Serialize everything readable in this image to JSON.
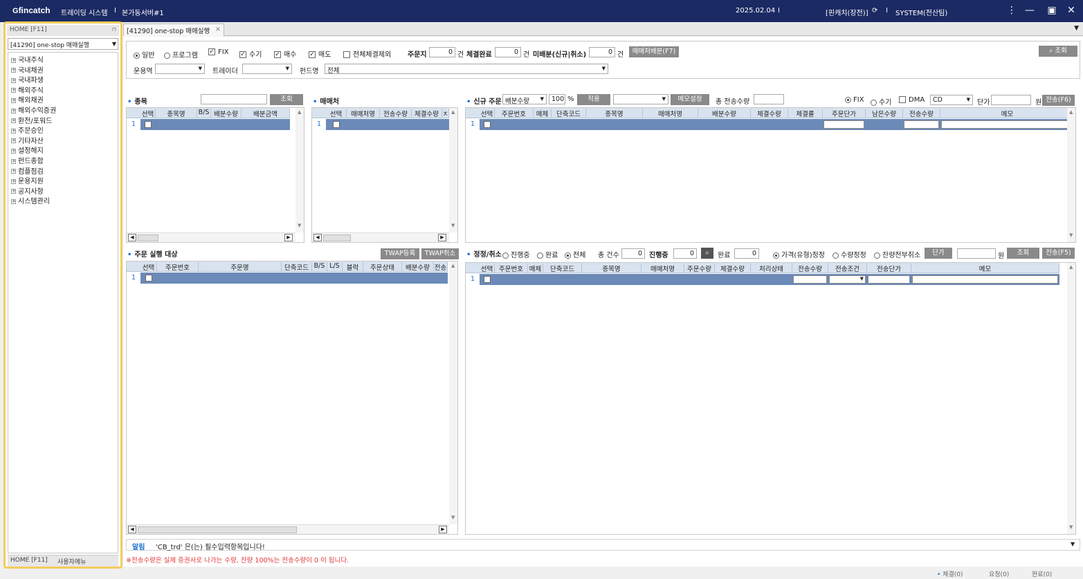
{
  "titlebar": {
    "logo": "fincatch",
    "app": "트레이딩 시스템",
    "sep1": "I",
    "server": "본가동서버#1",
    "date": "2025.02.04",
    "sep2": "I",
    "user_company": "[핀캐치(장전)]",
    "sep3": "I",
    "user": "SYSTEM(전산팀)"
  },
  "left": {
    "home_label": "HOME [F11]",
    "selected_menu": "[41290] one-stop 매매실행",
    "tree": [
      "국내주식",
      "국내채권",
      "국내파생",
      "해외주식",
      "해외채권",
      "해외수익증권",
      "환전/포워드",
      "주문승인",
      "기타자산",
      "설정해지",
      "펀드종합",
      "컴플점검",
      "운용지원",
      "공지사항",
      "시스템관리"
    ],
    "tab_home": "HOME [F11]",
    "tab_user": "사용자메뉴"
  },
  "tabs": {
    "active": "[41290] one-stop 매매실행"
  },
  "filter": {
    "radio_normal": "일반",
    "radio_program": "프로그램",
    "chk_fix": "FIX",
    "chk_manual": "수기",
    "chk_buy": "매수",
    "chk_sell": "매도",
    "chk_exclude_all": "전체체결제외",
    "order_label": "주문지",
    "order_count": "0",
    "unit": "건",
    "done_label": "체결완료",
    "done_count": "0",
    "unalloc_label": "미배분(신규|취소)",
    "unalloc_count": "0",
    "alloc_button": "매매처배분(F7)",
    "search_button": "조회",
    "manager_label": "운용역",
    "trader_label": "트레이더",
    "fund_label": "펀드명",
    "fund_value": "전체"
  },
  "stock_panel": {
    "title": "종목",
    "query_button": "조회",
    "headers": [
      "선택",
      "종목명",
      "B/S",
      "배분수량",
      "배분금액"
    ],
    "row_num": "1"
  },
  "broker_panel": {
    "title": "매매처",
    "headers": [
      "선택",
      "매매처명",
      "전송수량",
      "체결수량",
      "ㅈ"
    ],
    "row_num": "1"
  },
  "new_order": {
    "title": "신규 주문",
    "mode": "배분수량",
    "pct": "100",
    "pct_unit": "%",
    "apply_button": "적용",
    "memo_button": "메모설정",
    "total_label": "총 전송수량",
    "radio_fix": "FIX",
    "radio_manual": "수기",
    "chk_dma": "DMA",
    "dma_value": "CD",
    "price_label": "단가",
    "won": "원",
    "send_button": "전송(F6)",
    "headers": [
      "선택",
      "주문번호",
      "매체",
      "단축코드",
      "종목명",
      "매매처명",
      "배분수량",
      "체결수량",
      "체결률",
      "주문단가",
      "남은수량",
      "전송수량",
      "메모"
    ],
    "row_num": "1"
  },
  "exec_panel": {
    "title": "주문 실행 대상",
    "twap_register": "TWAP등록",
    "twap_cancel": "TWAP취소",
    "headers": [
      "선택",
      "주문번호",
      "주문명",
      "단축코드",
      "B/S",
      "L/S",
      "블럭",
      "주문상태",
      "배분수량",
      "전송"
    ],
    "row_num": "1"
  },
  "amend": {
    "title": "정정/취소",
    "radio_progress": "진행중",
    "radio_done": "완료",
    "radio_all": "전체",
    "total_label": "총 건수",
    "total_count": "0",
    "progress_label": "진행중",
    "progress_count": "0",
    "done_label": "완료",
    "done_count": "0",
    "radio_price": "가격(유형)정정",
    "radio_qty": "수량정정",
    "radio_cancel": "잔량전부취소",
    "price_button": "단가",
    "won": "원",
    "query_button": "조회",
    "send_button": "전송(F5)",
    "headers": [
      "선택",
      "주문번호",
      "매체",
      "단축코드",
      "종목명",
      "매매처명",
      "주문수량",
      "체결수량",
      "처리상태",
      "전송수량",
      "전송조건",
      "전송단가",
      "메모"
    ],
    "row_num": "1"
  },
  "alert": {
    "label": "알림",
    "message": "'CB_trd' 은(는) 필수입력항목입니다!",
    "note": "※전송수량은 실제 증권사로 나가는 수량, 잔량 100%는 전송수량이 0 이 됩니다."
  },
  "status": {
    "filled": "체결(0)",
    "request": "요청(0)",
    "done": "완료(0)"
  }
}
